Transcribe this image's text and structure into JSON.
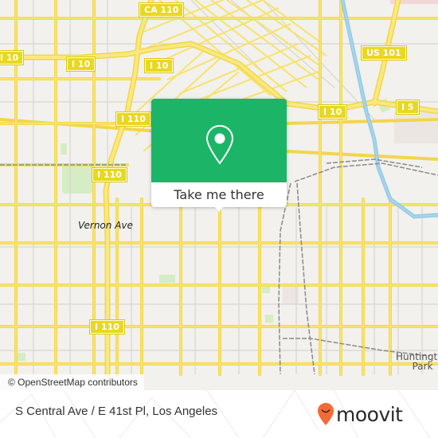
{
  "map": {
    "highway_shields": [
      {
        "label": "CA 110"
      },
      {
        "label": "I 10"
      },
      {
        "label": "I 10"
      },
      {
        "label": "I 10"
      },
      {
        "label": "US 101"
      },
      {
        "label": "I 10"
      },
      {
        "label": "I 5"
      },
      {
        "label": "I 110"
      },
      {
        "label": "I 110"
      },
      {
        "label": "I 110"
      }
    ],
    "place_labels": {
      "vernon_ave": "Vernon Ave",
      "huntington_park_line1": "Huntington",
      "huntington_park_line2": "Park"
    },
    "attribution": "© OpenStreetMap contributors",
    "colors": {
      "background": "#f2f1ed",
      "road": "#f7e36a",
      "river": "#a5d3ec",
      "rail": "#888888",
      "park": "#d6ecc4"
    }
  },
  "popup": {
    "icon": "location-pin-icon",
    "button_label": "Take me there",
    "color": "#1cb567"
  },
  "footer": {
    "address": "S Central Ave / E 41st Pl, Los Angeles",
    "brand": "moovit",
    "brand_color": "#f26a36"
  }
}
